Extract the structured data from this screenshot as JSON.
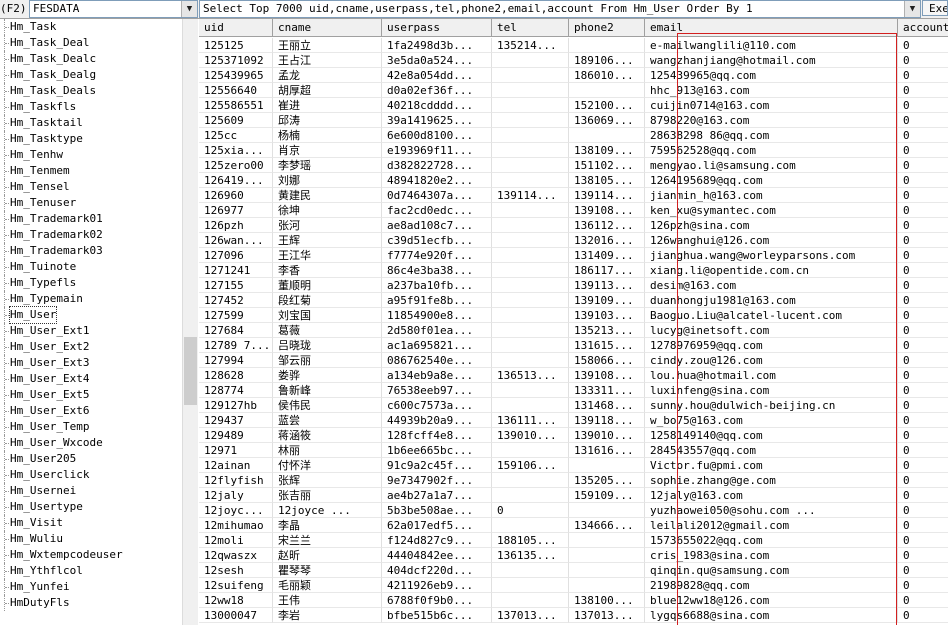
{
  "toolbar": {
    "f2_label": "(F2)",
    "database": "FESDATA",
    "sql": "Select Top 7000 uid,cname,userpass,tel,phone2,email,account From Hm_User Order By 1",
    "exec_label": "Exec"
  },
  "tables": [
    "Hm_Task",
    "Hm_Task_Deal",
    "Hm_Task_Dealc",
    "Hm_Task_Dealg",
    "Hm_Task_Deals",
    "Hm_Taskfls",
    "Hm_Tasktail",
    "Hm_Tasktype",
    "Hm_Tenhw",
    "Hm_Tenmem",
    "Hm_Tensel",
    "Hm_Tenuser",
    "Hm_Trademark01",
    "Hm_Trademark02",
    "Hm_Trademark03",
    "Hm_Tuinote",
    "Hm_Typefls",
    "Hm_Typemain",
    "Hm_User",
    "Hm_User_Ext1",
    "Hm_User_Ext2",
    "Hm_User_Ext3",
    "Hm_User_Ext4",
    "Hm_User_Ext5",
    "Hm_User_Ext6",
    "Hm_User_Temp",
    "Hm_User_Wxcode",
    "Hm_User205",
    "Hm_Userclick",
    "Hm_Usernei",
    "Hm_Usertype",
    "Hm_Visit",
    "Hm_Wuliu",
    "Hm_Wxtempcodeuser",
    "Hm_Ythflcol",
    "Hm_Yunfei",
    "HmDutyFls"
  ],
  "selected_table": "Hm_User",
  "grid": {
    "columns": [
      "uid",
      "cname",
      "userpass",
      "tel",
      "phone2",
      "email",
      "account"
    ],
    "rows": [
      [
        "125125",
        "王丽立",
        "1fa2498d3b...",
        "135214...",
        "",
        "e-mailwanglili@110.com",
        "0"
      ],
      [
        "125371092",
        "王占江",
        "3e5da0a524...",
        "",
        "189106...",
        "wangzhanjiang@hotmail.com",
        "0"
      ],
      [
        "125439965",
        "孟龙",
        "42e8a054dd...",
        "",
        "186010...",
        "125439965@qq.com",
        "0"
      ],
      [
        "12556640",
        "胡厚超",
        "d0a02ef36f...",
        "",
        "",
        "hhc_913@163.com",
        "0"
      ],
      [
        "125586551",
        "崔进",
        "40218cdddd...",
        "",
        "152100...",
        "cuijin0714@163.com",
        "0"
      ],
      [
        "125609",
        "邱涛",
        "39a1419625...",
        "",
        "136069...",
        "8798220@163.com",
        "0"
      ],
      [
        "125cc",
        "杨楠",
        "6e600d8100...",
        "",
        "",
        "28638298 86@qq.com",
        "0"
      ],
      [
        "125xia...",
        "肖京",
        "e193969f11...",
        "",
        "138109...",
        "759562528@qq.com",
        "0"
      ],
      [
        "125zero00",
        "李梦瑶",
        "d382822728...",
        "",
        "151102...",
        "mengyao.li@samsung.com",
        "0"
      ],
      [
        "126419...",
        "刘娜",
        "48941820e2...",
        "",
        "138105...",
        "1264195689@qq.com",
        "0"
      ],
      [
        "126960",
        "黄建民",
        "0d7464307a...",
        "139114...",
        "139114...",
        "jianmin_h@163.com",
        "0"
      ],
      [
        "126977",
        "徐坤",
        "fac2cd0edc...",
        "",
        "139108...",
        "ken_xu@symantec.com",
        "0"
      ],
      [
        "126pzh",
        "张河",
        "ae8ad108c7...",
        "",
        "136112...",
        "126pzh@sina.com",
        "0"
      ],
      [
        "126wan...",
        "王辉",
        "c39d51ecfb...",
        "",
        "132016...",
        "126wanghui@126.com",
        "0"
      ],
      [
        "127096",
        "王江华",
        "f7774e920f...",
        "",
        "131409...",
        "jianghua.wang@worleyparsons.com",
        "0"
      ],
      [
        "1271241",
        "李香",
        "86c4e3ba38...",
        "",
        "186117...",
        "xiang.li@opentide.com.cn",
        "0"
      ],
      [
        "127155",
        "董顺明",
        "a237ba10fb...",
        "",
        "139113...",
        "desim@163.com",
        "0"
      ],
      [
        "127452",
        "段红菊",
        "a95f91fe8b...",
        "",
        "139109...",
        "duanhongju1981@163.com",
        "0"
      ],
      [
        "127599",
        "刘宝国",
        "11854900e8...",
        "",
        "139103...",
        "Baoguo.Liu@alcatel-lucent.com",
        "0"
      ],
      [
        "127684",
        "葛薇",
        "2d580f01ea...",
        "",
        "135213...",
        "lucyg@inetsoft.com",
        "0"
      ],
      [
        "12789 7...",
        "吕晓珑",
        "ac1a695821...",
        "",
        "131615...",
        "1278976959@qq.com",
        "0"
      ],
      [
        "127994",
        "邹云丽",
        "086762540e...",
        "",
        "158066...",
        "cindy.zou@126.com",
        "0"
      ],
      [
        "128628",
        "娄骅",
        "a134eb9a8e...",
        "136513...",
        "139108...",
        "lou.hua@hotmail.com",
        "0"
      ],
      [
        "128774",
        "鲁新峰",
        "76538eeb97...",
        "",
        "133311...",
        "luxinfeng@sina.com",
        "0"
      ],
      [
        "129127hb",
        "侯伟民",
        "c600c7573a...",
        "",
        "131468...",
        "sunny.hou@dulwich-beijing.cn",
        "0"
      ],
      [
        "129437",
        "蓝尝",
        "44939b20a9...",
        "136111...",
        "139118...",
        "w_bo75@163.com",
        "0"
      ],
      [
        "129489",
        "蒋涵筱",
        "128fcff4e8...",
        "139010...",
        "139010...",
        "1258149140@qq.com",
        "0"
      ],
      [
        "12971",
        "林丽",
        "1b6ee665bc...",
        "",
        "131616...",
        "284543557@qq.com",
        "0"
      ],
      [
        "12ainan",
        "付怀洋",
        "91c9a2c45f...",
        "159106...",
        "",
        "Victor.fu@pmi.com",
        "0"
      ],
      [
        "12flyfish",
        "张辉",
        "9e7347902f...",
        "",
        "135205...",
        "sophie.zhang@ge.com",
        "0"
      ],
      [
        "12jaly",
        "张吉丽",
        "ae4b27a1a7...",
        "",
        "159109...",
        "12jaly@163.com",
        "0"
      ],
      [
        "12joyc...",
        "12joyce    ...",
        "5b3be508ae...",
        "0",
        "",
        "yuzhaowei050@sohu.com      ...",
        "0"
      ],
      [
        "12mihumao",
        "李晶",
        "62a017edf5...",
        "",
        "134666...",
        "leilali2012@gmail.com",
        "0"
      ],
      [
        "12moli",
        "宋兰兰",
        "f124d827c9...",
        "188105...",
        "",
        "1573655022@qq.com",
        "0"
      ],
      [
        "12qwaszx",
        "赵昕",
        "44404842ee...",
        "136135...",
        "",
        "cris_1983@sina.com",
        "0"
      ],
      [
        "12sesh",
        "瞿琴琴",
        "404dcf220d...",
        "",
        "",
        "qinqin.qu@samsung.com",
        "0"
      ],
      [
        "12suifeng",
        "毛丽颖",
        "4211926eb9...",
        "",
        "",
        "21989828@qq.com",
        "0"
      ],
      [
        "12ww18",
        "王伟",
        "6788f0f9b0...",
        "",
        "138100...",
        "blue12ww18@126.com",
        "0"
      ],
      [
        "13000047",
        "李岩",
        "bfbe515b6c...",
        "137013...",
        "137013...",
        "lygqs6688@sina.com",
        "0"
      ]
    ]
  }
}
